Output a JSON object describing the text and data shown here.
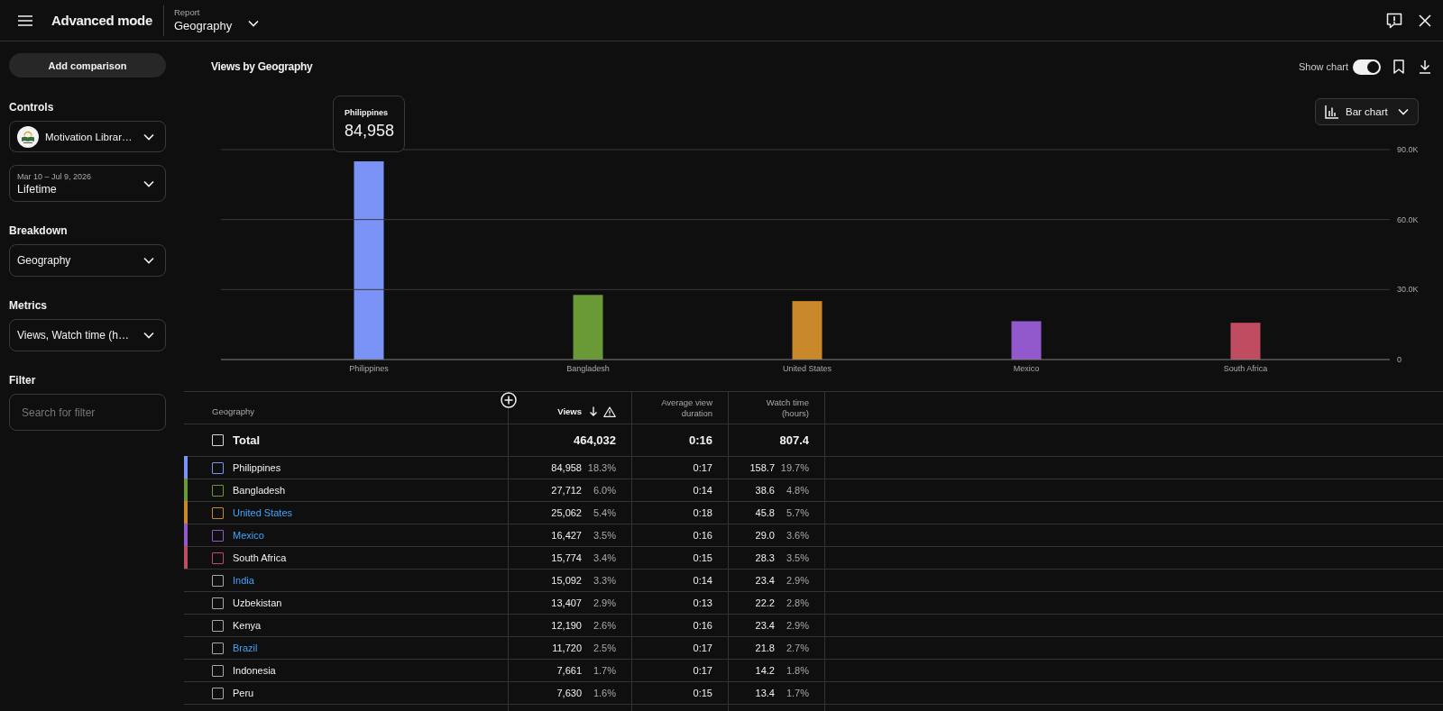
{
  "top_bar": {
    "title": "Advanced mode",
    "report_caption": "Report",
    "report": "Geography"
  },
  "sidebar": {
    "add_comparison": "Add comparison",
    "sections": [
      {
        "heading": "Controls",
        "controls": [
          {
            "kind": "channel",
            "value": "Motivation Librar…"
          },
          {
            "kind": "date",
            "caption": "Mar 10 – Jul 9, 2026",
            "value": "Lifetime"
          }
        ]
      },
      {
        "heading": "Breakdown",
        "controls": [
          {
            "kind": "select",
            "value": "Geography"
          }
        ]
      },
      {
        "heading": "Metrics",
        "controls": [
          {
            "kind": "select",
            "value": "Views, Watch time (h…"
          }
        ]
      },
      {
        "heading": "Filter",
        "controls": [
          {
            "kind": "search",
            "placeholder": "Search for filter"
          }
        ]
      }
    ]
  },
  "chart": {
    "show_chart": {
      "label": "Show chart",
      "on": true
    },
    "chart_type": "Bar chart",
    "tooltip": {
      "label": "Philippines",
      "value": "84,958"
    },
    "chart_data": {
      "type": "bar",
      "title": "Views by Geography",
      "categories": [
        "Philippines",
        "Bangladesh",
        "United States",
        "Mexico",
        "South Africa"
      ],
      "values": [
        84958,
        27712,
        25062,
        16427,
        15774
      ],
      "ylim": [
        0,
        90000
      ],
      "yticks": [
        {
          "value": 0,
          "label": "0"
        },
        {
          "value": 30000,
          "label": "30.0K"
        },
        {
          "value": 60000,
          "label": "60.0K"
        },
        {
          "value": 90000,
          "label": "90.0K"
        }
      ]
    }
  },
  "table": {
    "columns": [
      {
        "label": "Geography",
        "sorted": false,
        "warning": false
      },
      {
        "label": "Views",
        "sorted": true,
        "warning": true
      },
      {
        "label": "Average view duration",
        "sorted": false,
        "warning": false
      },
      {
        "label": "Watch time (hours)",
        "sorted": false,
        "warning": false
      }
    ],
    "total": {
      "label": "Total",
      "checked": false,
      "views": "464,032",
      "avg_duration": "0:16",
      "watch_time": "807.4"
    },
    "rows": [
      {
        "name": "Philippines",
        "color": "#7b93f7",
        "link": false,
        "checked": false,
        "views": "84,958",
        "views_share": "18.3%",
        "avg_duration": "0:17",
        "watch_time": "158.7",
        "watch_share": "19.7%"
      },
      {
        "name": "Bangladesh",
        "color": "#6a9a35",
        "link": false,
        "checked": false,
        "views": "27,712",
        "views_share": "6.0%",
        "avg_duration": "0:14",
        "watch_time": "38.6",
        "watch_share": "4.8%"
      },
      {
        "name": "United States",
        "color": "#c9892a",
        "link": true,
        "checked": false,
        "views": "25,062",
        "views_share": "5.4%",
        "avg_duration": "0:18",
        "watch_time": "45.8",
        "watch_share": "5.7%"
      },
      {
        "name": "Mexico",
        "color": "#9159cc",
        "link": true,
        "checked": false,
        "views": "16,427",
        "views_share": "3.5%",
        "avg_duration": "0:16",
        "watch_time": "29.0",
        "watch_share": "3.6%"
      },
      {
        "name": "South Africa",
        "color": "#c04c62",
        "link": false,
        "checked": false,
        "views": "15,774",
        "views_share": "3.4%",
        "avg_duration": "0:15",
        "watch_time": "28.3",
        "watch_share": "3.5%"
      },
      {
        "name": "India",
        "link": true,
        "checked": false,
        "views": "15,092",
        "views_share": "3.3%",
        "avg_duration": "0:14",
        "watch_time": "23.4",
        "watch_share": "2.9%"
      },
      {
        "name": "Uzbekistan",
        "link": false,
        "checked": false,
        "views": "13,407",
        "views_share": "2.9%",
        "avg_duration": "0:13",
        "watch_time": "22.2",
        "watch_share": "2.8%"
      },
      {
        "name": "Kenya",
        "link": false,
        "checked": false,
        "views": "12,190",
        "views_share": "2.6%",
        "avg_duration": "0:16",
        "watch_time": "23.4",
        "watch_share": "2.9%"
      },
      {
        "name": "Brazil",
        "link": true,
        "checked": false,
        "views": "11,720",
        "views_share": "2.5%",
        "avg_duration": "0:17",
        "watch_time": "21.8",
        "watch_share": "2.7%"
      },
      {
        "name": "Indonesia",
        "link": false,
        "checked": false,
        "views": "7,661",
        "views_share": "1.7%",
        "avg_duration": "0:17",
        "watch_time": "14.2",
        "watch_share": "1.8%"
      },
      {
        "name": "Peru",
        "link": false,
        "checked": false,
        "views": "7,630",
        "views_share": "1.6%",
        "avg_duration": "0:15",
        "watch_time": "13.4",
        "watch_share": "1.7%"
      }
    ]
  }
}
